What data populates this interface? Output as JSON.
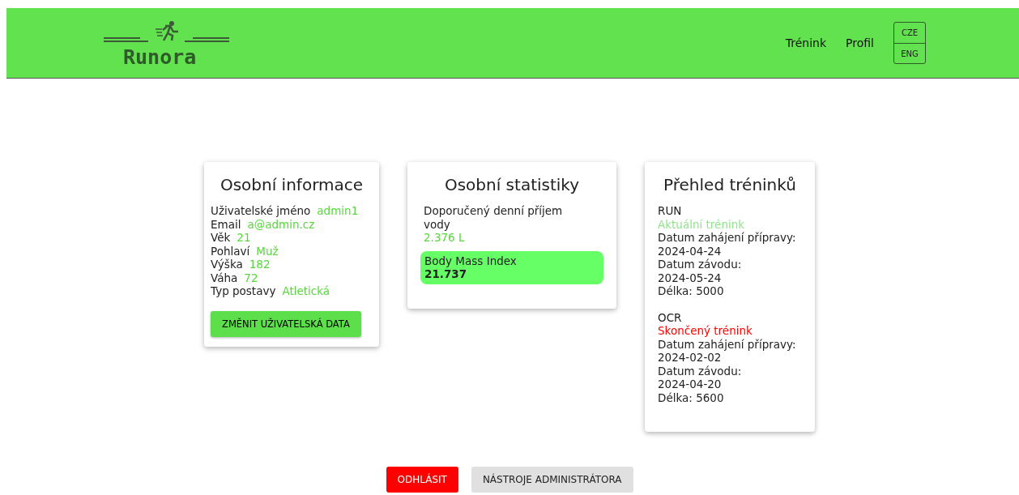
{
  "header": {
    "logo": "Runora",
    "nav": [
      "Trénink",
      "Profil"
    ],
    "languages": [
      "CZE",
      "ENG"
    ]
  },
  "personal_info": {
    "title": "Osobní informace",
    "fields": [
      {
        "label": "Uživatelské jméno",
        "value": "admin1"
      },
      {
        "label": "Email",
        "value": "a@admin.cz"
      },
      {
        "label": "Věk",
        "value": "21"
      },
      {
        "label": "Pohlaví",
        "value": "Muž"
      },
      {
        "label": "Výška",
        "value": "182"
      },
      {
        "label": "Váha",
        "value": "72"
      },
      {
        "label": "Typ postavy",
        "value": "Atletická"
      }
    ],
    "button": "ZMĚNIT UŽIVATELSKÁ DATA"
  },
  "stats": {
    "title": "Osobní statistiky",
    "water_label": "Doporučený denní příjem vody",
    "water_value": "2.376 L",
    "bmi_label": "Body Mass Index",
    "bmi_value": "21.737"
  },
  "trainings": {
    "title": "Přehled tréninků",
    "items": [
      {
        "name": "RUN",
        "status": "Aktuální trénink",
        "kind": "current",
        "start_label": "Datum zahájení přípravy:",
        "start": "2024-04-24",
        "race_label": "Datum závodu:",
        "race": "2024-05-24",
        "length": "Délka: 5000"
      },
      {
        "name": "OCR",
        "status": "Skončený trénink",
        "kind": "finished",
        "start_label": "Datum zahájení přípravy:",
        "start": "2024-02-02",
        "race_label": "Datum závodu:",
        "race": "2024-04-20",
        "length": "Délka: 5600"
      }
    ]
  },
  "actions": [
    {
      "label": "ODHLÁSIT",
      "kind": "danger"
    },
    {
      "label": "NÁSTROJE ADMINISTRÁTORA",
      "kind": "secondary"
    }
  ]
}
